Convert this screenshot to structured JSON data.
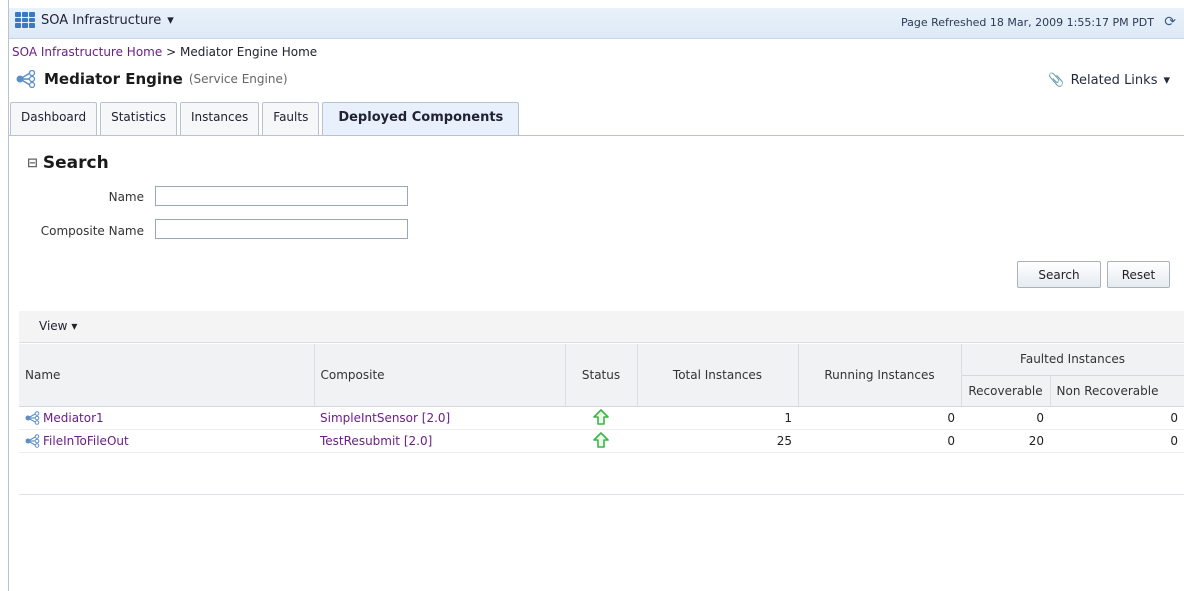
{
  "topbar": {
    "app_name": "SOA Infrastructure",
    "page_refreshed": "Page Refreshed 18 Mar, 2009 1:55:17 PM PDT"
  },
  "breadcrumb": {
    "home": "SOA Infrastructure Home",
    "separator": ">",
    "current": "Mediator Engine Home"
  },
  "header": {
    "title": "Mediator Engine",
    "subtitle": "(Service Engine)",
    "related_links": "Related Links"
  },
  "tabs": [
    {
      "label": "Dashboard"
    },
    {
      "label": "Statistics"
    },
    {
      "label": "Instances"
    },
    {
      "label": "Faults"
    },
    {
      "label": "Deployed Components"
    }
  ],
  "search": {
    "title": "Search",
    "name_label": "Name",
    "name_value": "",
    "composite_label": "Composite Name",
    "composite_value": "",
    "search_button": "Search",
    "reset_button": "Reset"
  },
  "view_menu": "View",
  "table": {
    "headers": {
      "name": "Name",
      "composite": "Composite",
      "status": "Status",
      "total": "Total Instances",
      "running": "Running Instances",
      "faulted": "Faulted Instances",
      "recoverable": "Recoverable",
      "non_recoverable": "Non Recoverable"
    },
    "rows": [
      {
        "name": "Mediator1",
        "composite": "SimpleIntSensor [2.0]",
        "status": "up-arrow-icon",
        "total": "1",
        "running": "0",
        "recoverable": "0",
        "non_recoverable": "0"
      },
      {
        "name": "FileInToFileOut",
        "composite": "TestResubmit [2.0]",
        "status": "up-arrow-icon",
        "total": "25",
        "running": "0",
        "recoverable": "20",
        "non_recoverable": "0"
      }
    ]
  },
  "colors": {
    "link": "#6b1f86",
    "status_up": "#3bb54a",
    "topbar": "#e3eef9"
  }
}
